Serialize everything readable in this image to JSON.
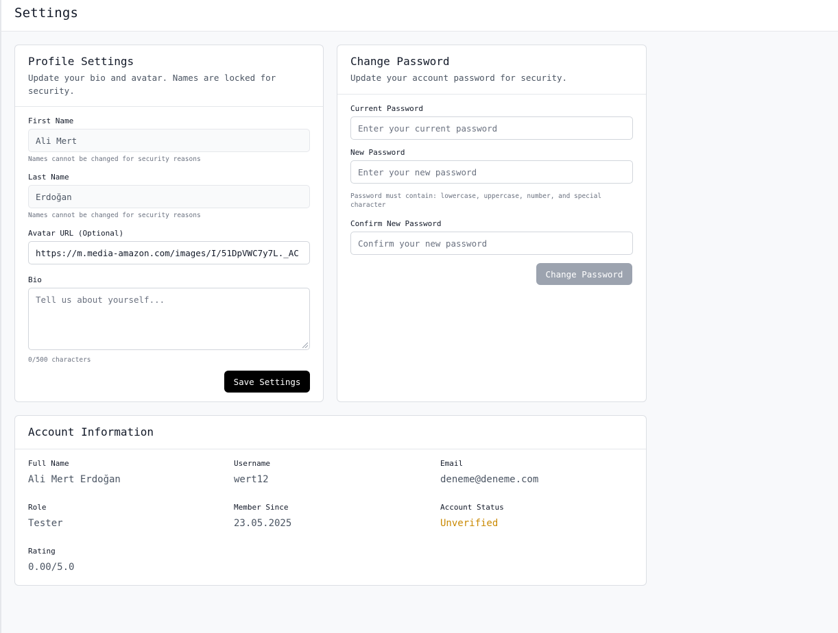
{
  "page": {
    "title": "Settings"
  },
  "profile": {
    "title": "Profile Settings",
    "description": "Update your bio and avatar. Names are locked for security.",
    "first_name": {
      "label": "First Name",
      "value": "Ali Mert",
      "hint": "Names cannot be changed for security reasons"
    },
    "last_name": {
      "label": "Last Name",
      "value": "Erdoğan",
      "hint": "Names cannot be changed for security reasons"
    },
    "avatar_url": {
      "label": "Avatar URL (Optional)",
      "value": "https://m.media-amazon.com/images/I/51DpVWC7y7L._AC"
    },
    "bio": {
      "label": "Bio",
      "placeholder": "Tell us about yourself...",
      "counter": "0/500 characters"
    },
    "save_label": "Save Settings"
  },
  "password": {
    "title": "Change Password",
    "description": "Update your account password for security.",
    "current": {
      "label": "Current Password",
      "placeholder": "Enter your current password"
    },
    "new": {
      "label": "New Password",
      "placeholder": "Enter your new password",
      "hint": "Password must contain: lowercase, uppercase, number, and special character"
    },
    "confirm": {
      "label": "Confirm New Password",
      "placeholder": "Confirm your new password"
    },
    "submit_label": "Change Password"
  },
  "account": {
    "title": "Account Information",
    "full_name": {
      "label": "Full Name",
      "value": "Ali Mert Erdoğan"
    },
    "username": {
      "label": "Username",
      "value": "wert12"
    },
    "email": {
      "label": "Email",
      "value": "deneme@deneme.com"
    },
    "role": {
      "label": "Role",
      "value": "Tester"
    },
    "member_since": {
      "label": "Member Since",
      "value": "23.05.2025"
    },
    "status": {
      "label": "Account Status",
      "value": "Unverified",
      "color": "#ca8a04"
    },
    "rating": {
      "label": "Rating",
      "value": "0.00/5.0"
    }
  }
}
